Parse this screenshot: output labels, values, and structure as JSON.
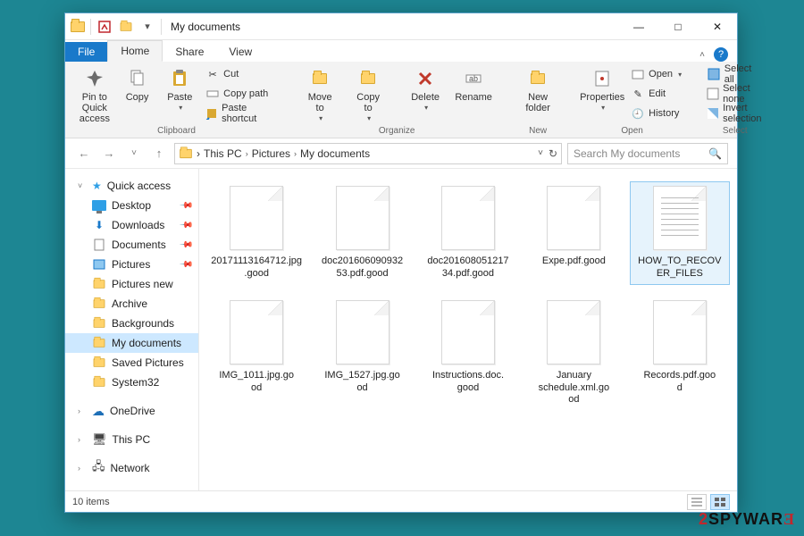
{
  "titlebar": {
    "title": "My documents",
    "qat_down": "▾"
  },
  "win": {
    "min": "—",
    "max": "□",
    "close": "✕"
  },
  "tabs": {
    "file": "File",
    "home": "Home",
    "share": "Share",
    "view": "View",
    "collapse": "˄",
    "help": "?"
  },
  "ribbon": {
    "clipboard": {
      "label": "Clipboard",
      "pin": "Pin to Quick\naccess",
      "copy": "Copy",
      "paste": "Paste",
      "cut": "Cut",
      "copy_path": "Copy path",
      "paste_shortcut": "Paste shortcut"
    },
    "organize": {
      "label": "Organize",
      "move_to": "Move\nto",
      "copy_to": "Copy\nto",
      "delete": "Delete",
      "rename": "Rename"
    },
    "new": {
      "label": "New",
      "new_folder": "New\nfolder"
    },
    "open": {
      "label": "Open",
      "properties": "Properties",
      "open": "Open",
      "edit": "Edit",
      "history": "History"
    },
    "select": {
      "label": "Select",
      "select_all": "Select all",
      "select_none": "Select none",
      "invert": "Invert selection"
    }
  },
  "nav": {
    "back": "←",
    "forward": "→",
    "recent": "˅",
    "up": "↑",
    "dd": "˅",
    "refresh": "↻"
  },
  "breadcrumb": {
    "a": "This PC",
    "b": "Pictures",
    "c": "My documents",
    "caret": "›"
  },
  "search": {
    "placeholder": "Search My documents",
    "icon": "🔍"
  },
  "sidebar": {
    "quick_access": "Quick access",
    "desktop": "Desktop",
    "downloads": "Downloads",
    "documents": "Documents",
    "pictures": "Pictures",
    "pictures_new": "Pictures new",
    "archive": "Archive",
    "backgrounds": "Backgrounds",
    "my_documents": "My documents",
    "saved_pictures": "Saved Pictures",
    "system32": "System32",
    "onedrive": "OneDrive",
    "this_pc": "This PC",
    "network": "Network"
  },
  "files": [
    {
      "name": "20171113164712.jpg.good",
      "selected": false,
      "text": false
    },
    {
      "name": "doc201606090932\n53.pdf.good",
      "selected": false,
      "text": false
    },
    {
      "name": "doc201608051217\n34.pdf.good",
      "selected": false,
      "text": false
    },
    {
      "name": "Expe.pdf.good",
      "selected": false,
      "text": false
    },
    {
      "name": "HOW_TO_RECOV\nER_FILES",
      "selected": true,
      "text": true
    },
    {
      "name": "IMG_1011.jpg.go\nod",
      "selected": false,
      "text": false
    },
    {
      "name": "IMG_1527.jpg.go\nod",
      "selected": false,
      "text": false
    },
    {
      "name": "Instructions.doc.\ngood",
      "selected": false,
      "text": false
    },
    {
      "name": "January\nschedule.xml.go\nod",
      "selected": false,
      "text": false
    },
    {
      "name": "Records.pdf.goo\nd",
      "selected": false,
      "text": false
    }
  ],
  "status": {
    "count": "10 items"
  },
  "watermark": {
    "two": "2",
    "spy": "SPYWAR",
    "eps": "Ǝ"
  }
}
